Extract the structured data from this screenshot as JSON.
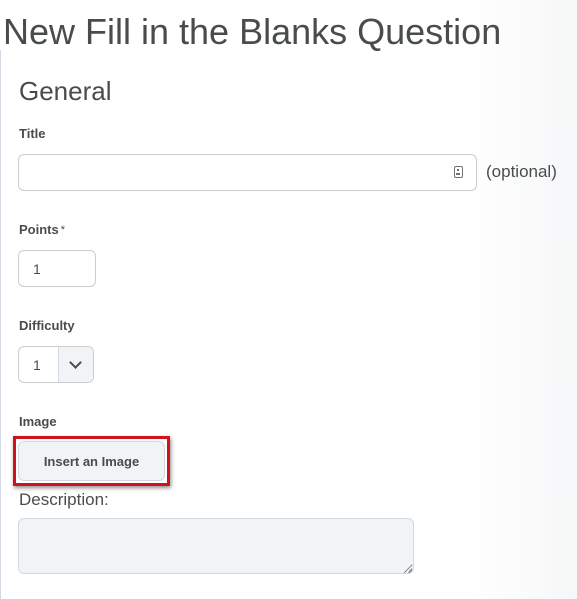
{
  "page": {
    "title": "New Fill in the Blanks Question"
  },
  "general": {
    "heading": "General",
    "title_field": {
      "label": "Title",
      "value": "",
      "placeholder": "",
      "hint": "(optional)",
      "icon": "contact-card-icon"
    },
    "points_field": {
      "label": "Points",
      "required_marker": "*",
      "value": "1"
    },
    "difficulty_field": {
      "label": "Difficulty",
      "selected": "1",
      "icon": "chevron-down-icon"
    },
    "image_field": {
      "label": "Image",
      "button_label": "Insert an Image",
      "highlight_color": "#d0121b"
    },
    "description_field": {
      "label": "Description:",
      "value": ""
    }
  }
}
